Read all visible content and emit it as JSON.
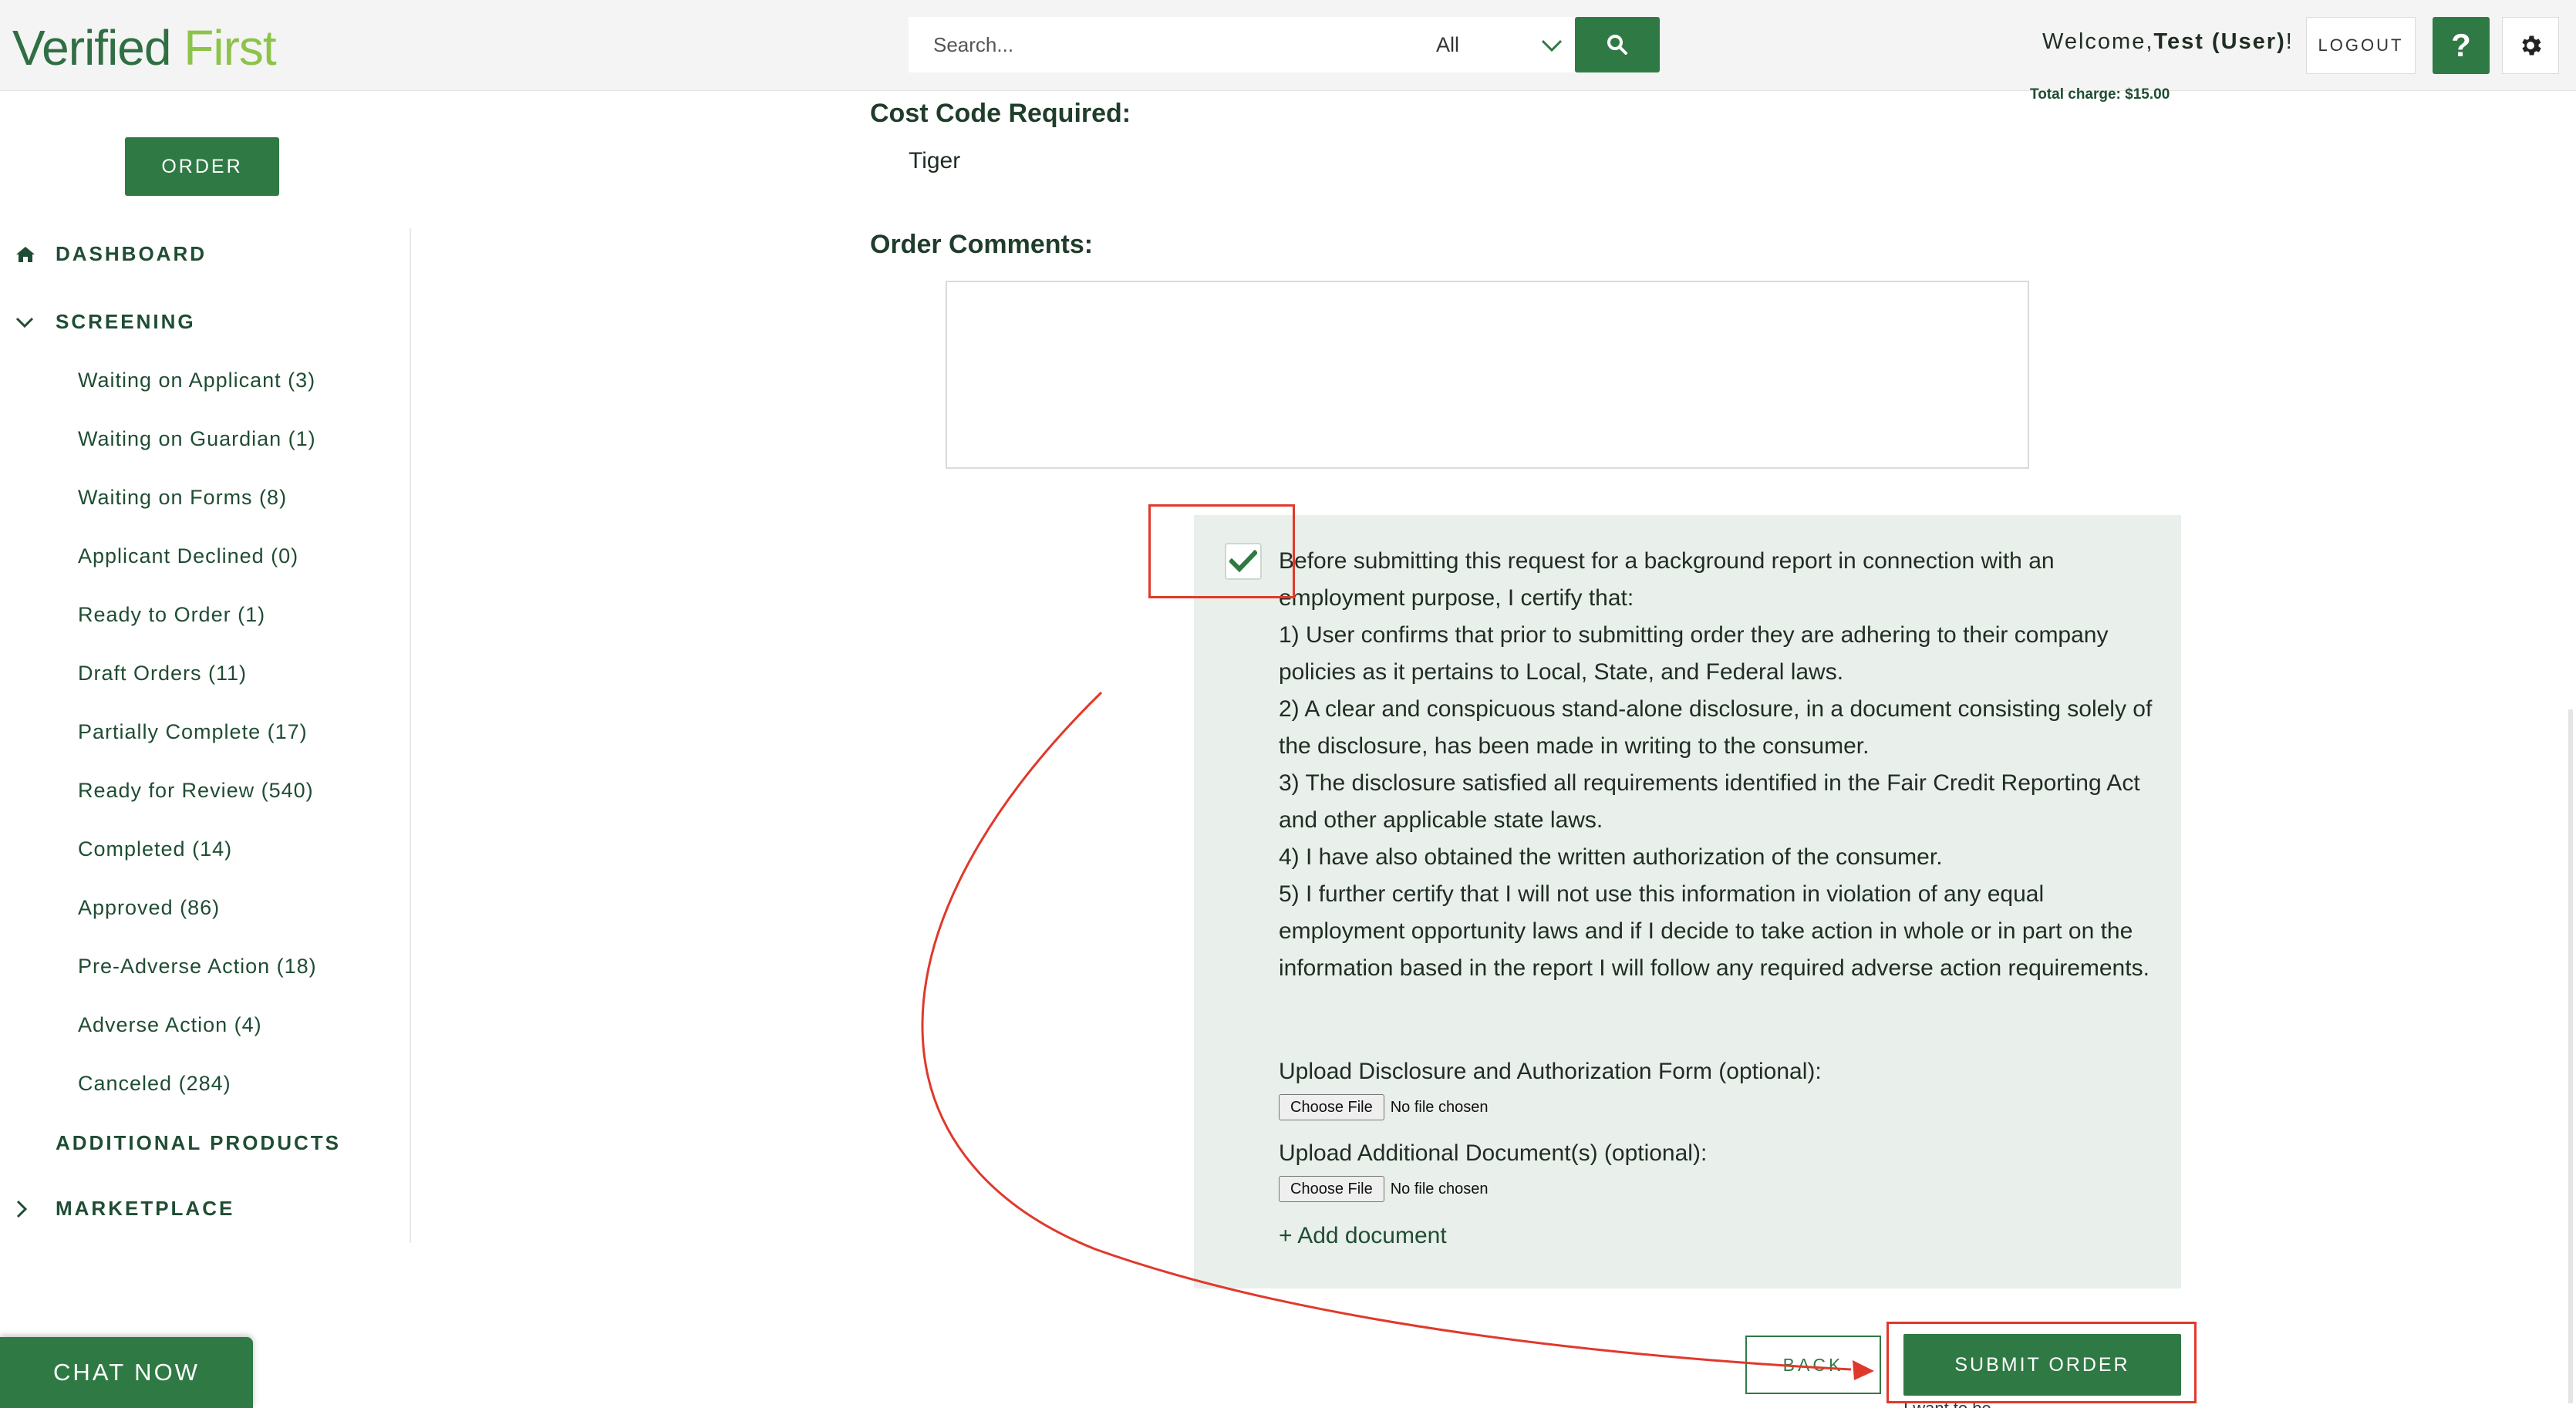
{
  "header": {
    "logo_part1": "Verified",
    "logo_part2": "First",
    "search_placeholder": "Search...",
    "search_scope": "All",
    "welcome_prefix": "Welcome,",
    "welcome_user": "Test (User)",
    "welcome_suffix": "!",
    "logout_label": "LOGOUT",
    "help_label": "?"
  },
  "sidebar": {
    "order_label": "ORDER",
    "dashboard_label": "DASHBOARD",
    "screening_label": "SCREENING",
    "screening_items": [
      "Waiting on Applicant (3)",
      "Waiting on Guardian (1)",
      "Waiting on Forms (8)",
      "Applicant Declined (0)",
      "Ready to Order (1)",
      "Draft Orders (11)",
      "Partially Complete (17)",
      "Ready for Review (540)",
      "Completed (14)",
      "Approved (86)",
      "Pre-Adverse Action (18)",
      "Adverse Action (4)",
      "Canceled (284)"
    ],
    "additional_products_label": "ADDITIONAL PRODUCTS",
    "marketplace_label": "MARKETPLACE"
  },
  "main": {
    "total_charge": "Total charge: $15.00",
    "cost_code_label": "Cost Code Required:",
    "cost_code_value": "Tiger",
    "order_comments_label": "Order Comments:",
    "order_comments_value": "",
    "certification_checked": true,
    "certification_lines": [
      "Before submitting this request for a background report in connection with an employment purpose, I certify that:",
      "1) User confirms that prior to submitting order they are adhering to their company policies as it pertains to Local, State, and Federal laws.",
      "2) A clear and conspicuous stand-alone disclosure, in a document consisting solely of the disclosure, has been made in writing to the consumer.",
      "3) The disclosure satisfied all requirements identified in the Fair Credit Reporting Act and other applicable state laws.",
      "4) I have also obtained the written authorization of the consumer.",
      "5) I further certify that I will not use this information in violation of any equal employment opportunity laws and if I decide to take action in whole or in part on the information based in the report I will follow any required adverse action requirements."
    ],
    "upload_disclosure_label": "Upload Disclosure and Authorization Form (optional):",
    "upload_additional_label": "Upload Additional Document(s) (optional):",
    "choose_file_label": "Choose File",
    "no_file_label": "No file chosen",
    "add_document_label": "+ Add document",
    "back_label": "BACK",
    "submit_label": "SUBMIT ORDER",
    "cut_text": "I want to be…"
  },
  "chat": {
    "label": "CHAT NOW"
  },
  "colors": {
    "brand_green": "#2f7a44",
    "logo_light_green": "#8dc34a",
    "panel_bg": "#e9efea",
    "annotation_red": "#e0392b"
  },
  "icons": [
    "search-icon",
    "chevron-down-icon",
    "help-icon",
    "gear-icon",
    "home-icon",
    "chevron-right-icon",
    "checkmark-icon"
  ]
}
